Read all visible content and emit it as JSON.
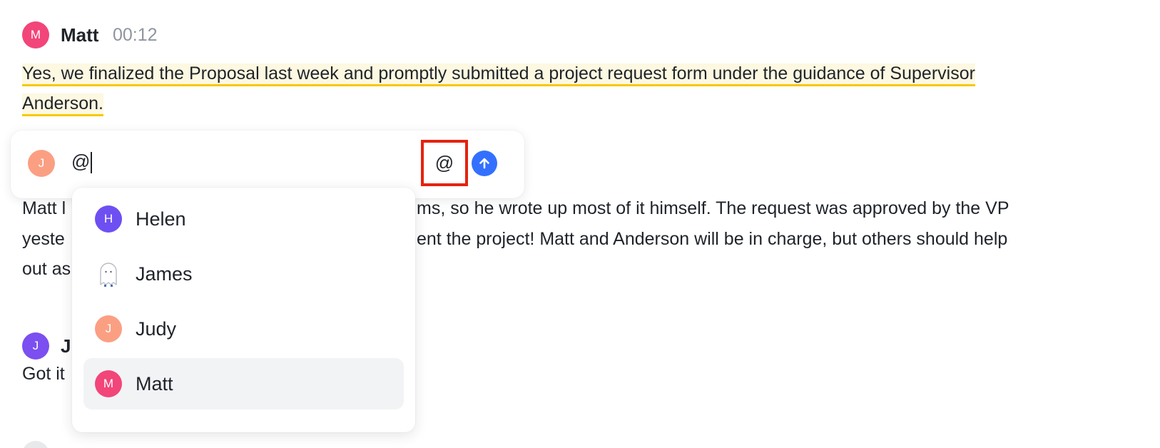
{
  "colors": {
    "matt": "#f2457a",
    "judy": "#fb9f83",
    "helen": "#6e4ff2",
    "james_msg": "#7b4ff0",
    "send": "#3370ff",
    "highlight_border": "#f7c900",
    "at_outline": "#e5220f"
  },
  "messages": [
    {
      "initial": "M",
      "author": "Matt",
      "time": "00:12",
      "line1": "Yes, we finalized the Proposal last week and promptly submitted a project request form under the guidance of Supervisor ",
      "line2": "Anderson. "
    },
    {
      "line1": "Matt l",
      "line1_right": "ms, so he wrote up most of it himself. The request was approved by the VP",
      "line2_left": "yeste",
      "line2_right": "ent the project! Matt and Anderson will be in charge, but others should help",
      "line3": "out as"
    },
    {
      "initial": "J",
      "author_partial": "J",
      "body_partial": "Got it"
    }
  ],
  "composer": {
    "avatar_initial": "J",
    "input_value": "@",
    "at_icon": "at-sign-icon",
    "send_icon": "arrow-up-icon"
  },
  "mention_dropdown": {
    "items": [
      {
        "initial": "H",
        "name": "Helen",
        "icon": "avatar"
      },
      {
        "initial": "",
        "name": "James",
        "icon": "ghost-icon"
      },
      {
        "initial": "J",
        "name": "Judy",
        "icon": "avatar"
      },
      {
        "initial": "M",
        "name": "Matt",
        "icon": "avatar",
        "selected": true
      }
    ]
  }
}
